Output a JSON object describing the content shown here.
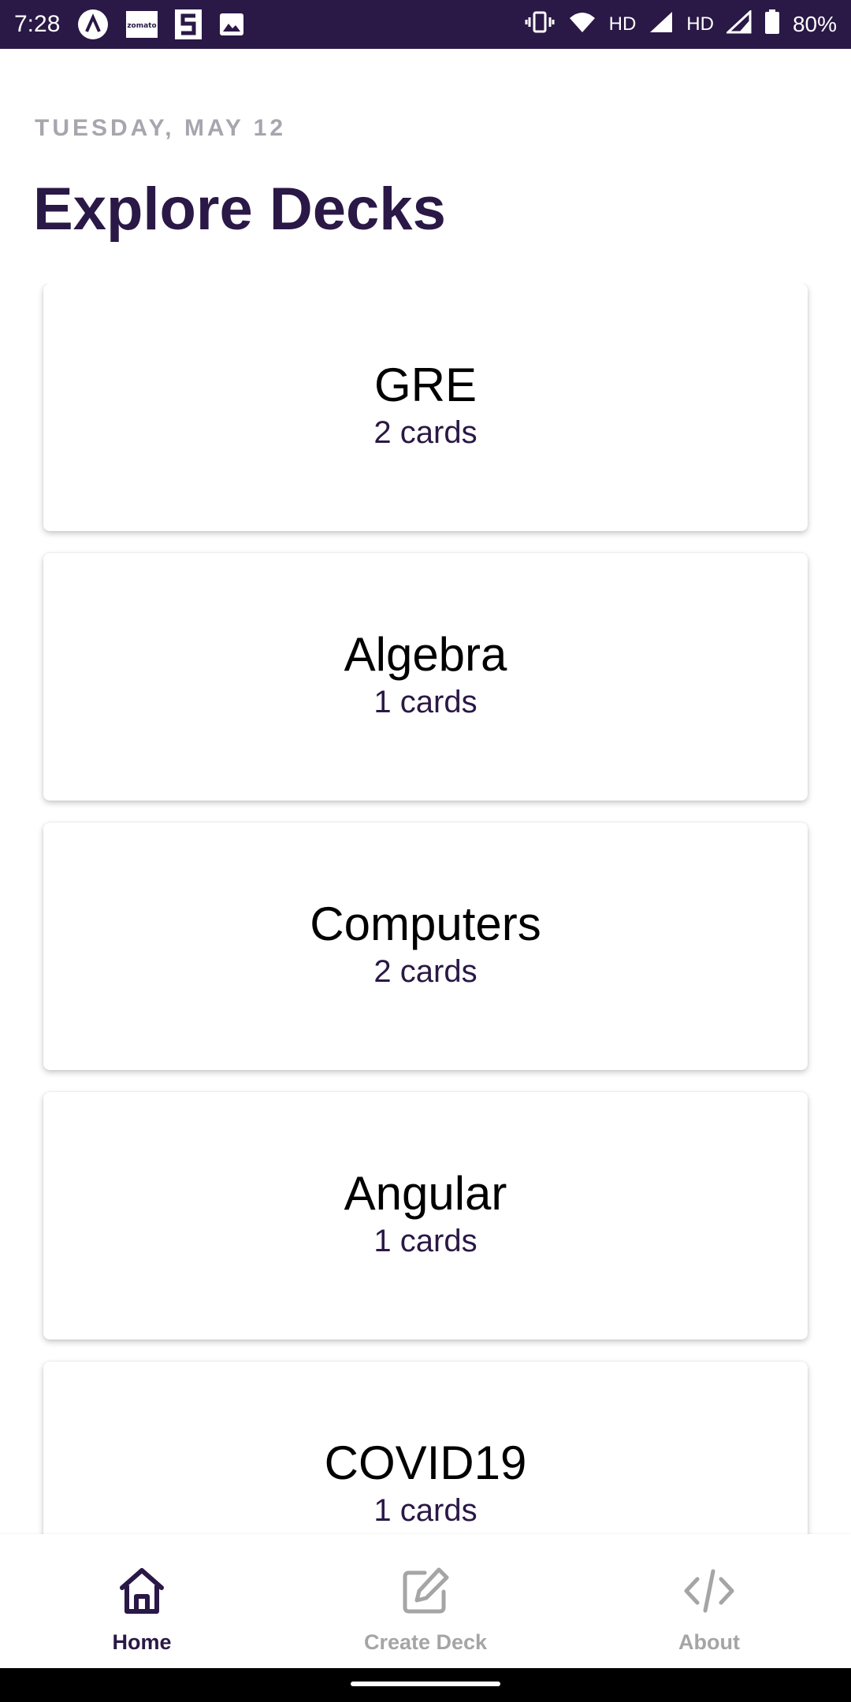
{
  "status_bar": {
    "time": "7:28",
    "notification_icons": [
      "app-icon",
      "zomato-icon",
      "app-icon",
      "image-icon"
    ],
    "zomato_text": "zomato",
    "hd1": "HD",
    "hd2": "HD",
    "battery": "80%",
    "background_color": "#2a1846"
  },
  "header": {
    "date": "TUESDAY, MAY 12",
    "title": "Explore Decks"
  },
  "decks": [
    {
      "name": "GRE",
      "count": "2 cards"
    },
    {
      "name": "Algebra",
      "count": "1 cards"
    },
    {
      "name": "Computers",
      "count": "2 cards"
    },
    {
      "name": "Angular",
      "count": "1 cards"
    },
    {
      "name": "COVID19",
      "count": "1 cards"
    }
  ],
  "bottom_nav": {
    "items": [
      {
        "label": "Home",
        "icon": "home-icon",
        "active": true
      },
      {
        "label": "Create Deck",
        "icon": "edit-icon",
        "active": false
      },
      {
        "label": "About",
        "icon": "code-icon",
        "active": false
      }
    ],
    "active_color": "#2a1846",
    "inactive_color": "#a5a5a5"
  }
}
